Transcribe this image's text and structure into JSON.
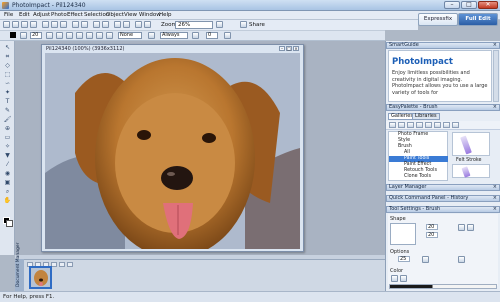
{
  "window": {
    "title": "PhotoImpact - Pil124340",
    "minimize": "–",
    "maximize": "□",
    "close": "✕"
  },
  "menubar": [
    "File",
    "Edit",
    "Adjust",
    "Photo",
    "Effect",
    "Selection",
    "Object",
    "View",
    "Window",
    "Help"
  ],
  "modes": {
    "expert": "Expressfix",
    "full": "Full Edit"
  },
  "toolbar": {
    "zoom_label": "Zoom",
    "zoom_value": "26%",
    "share_label": "Share"
  },
  "attribute_bar": {
    "size_value": "20",
    "blend_value": "None",
    "mode_value": "Always",
    "opacity_value": "0"
  },
  "document": {
    "title": "Pil124340 (100%) (3936x3112)",
    "photo_subject": "golden retriever puppy"
  },
  "filmstrip": {
    "tab_label": "Document Manager"
  },
  "status": {
    "text": "For Help, press F1."
  },
  "panels": {
    "smartguide": {
      "header": "SmartGuide",
      "title": "PhotoImpact",
      "body": "Enjoy limitless possibilities and creativity in digital imaging. PhotoImpact allows you to use a large variety of tools for"
    },
    "easypalette": {
      "header": "EasyPalette - Brush",
      "tabs": [
        "Galleries",
        "Libraries"
      ],
      "tree": [
        "Photo Frame",
        "Style",
        "Brush",
        "All",
        "Paint Tools",
        "Paint Effect",
        "Retouch Tools",
        "Clone Tools"
      ],
      "selected_index": 4,
      "previews": [
        "Felt Stroke",
        ""
      ]
    },
    "layer_manager": {
      "header": "Layer Manager"
    },
    "quick_command": {
      "header": "Quick Command Panel - History"
    },
    "tool_settings": {
      "header": "Tool Settings - Brush",
      "shape_label": "Shape",
      "size_value": "20",
      "options_label": "Options",
      "opacity_value": "25",
      "color_label": "Color"
    }
  }
}
